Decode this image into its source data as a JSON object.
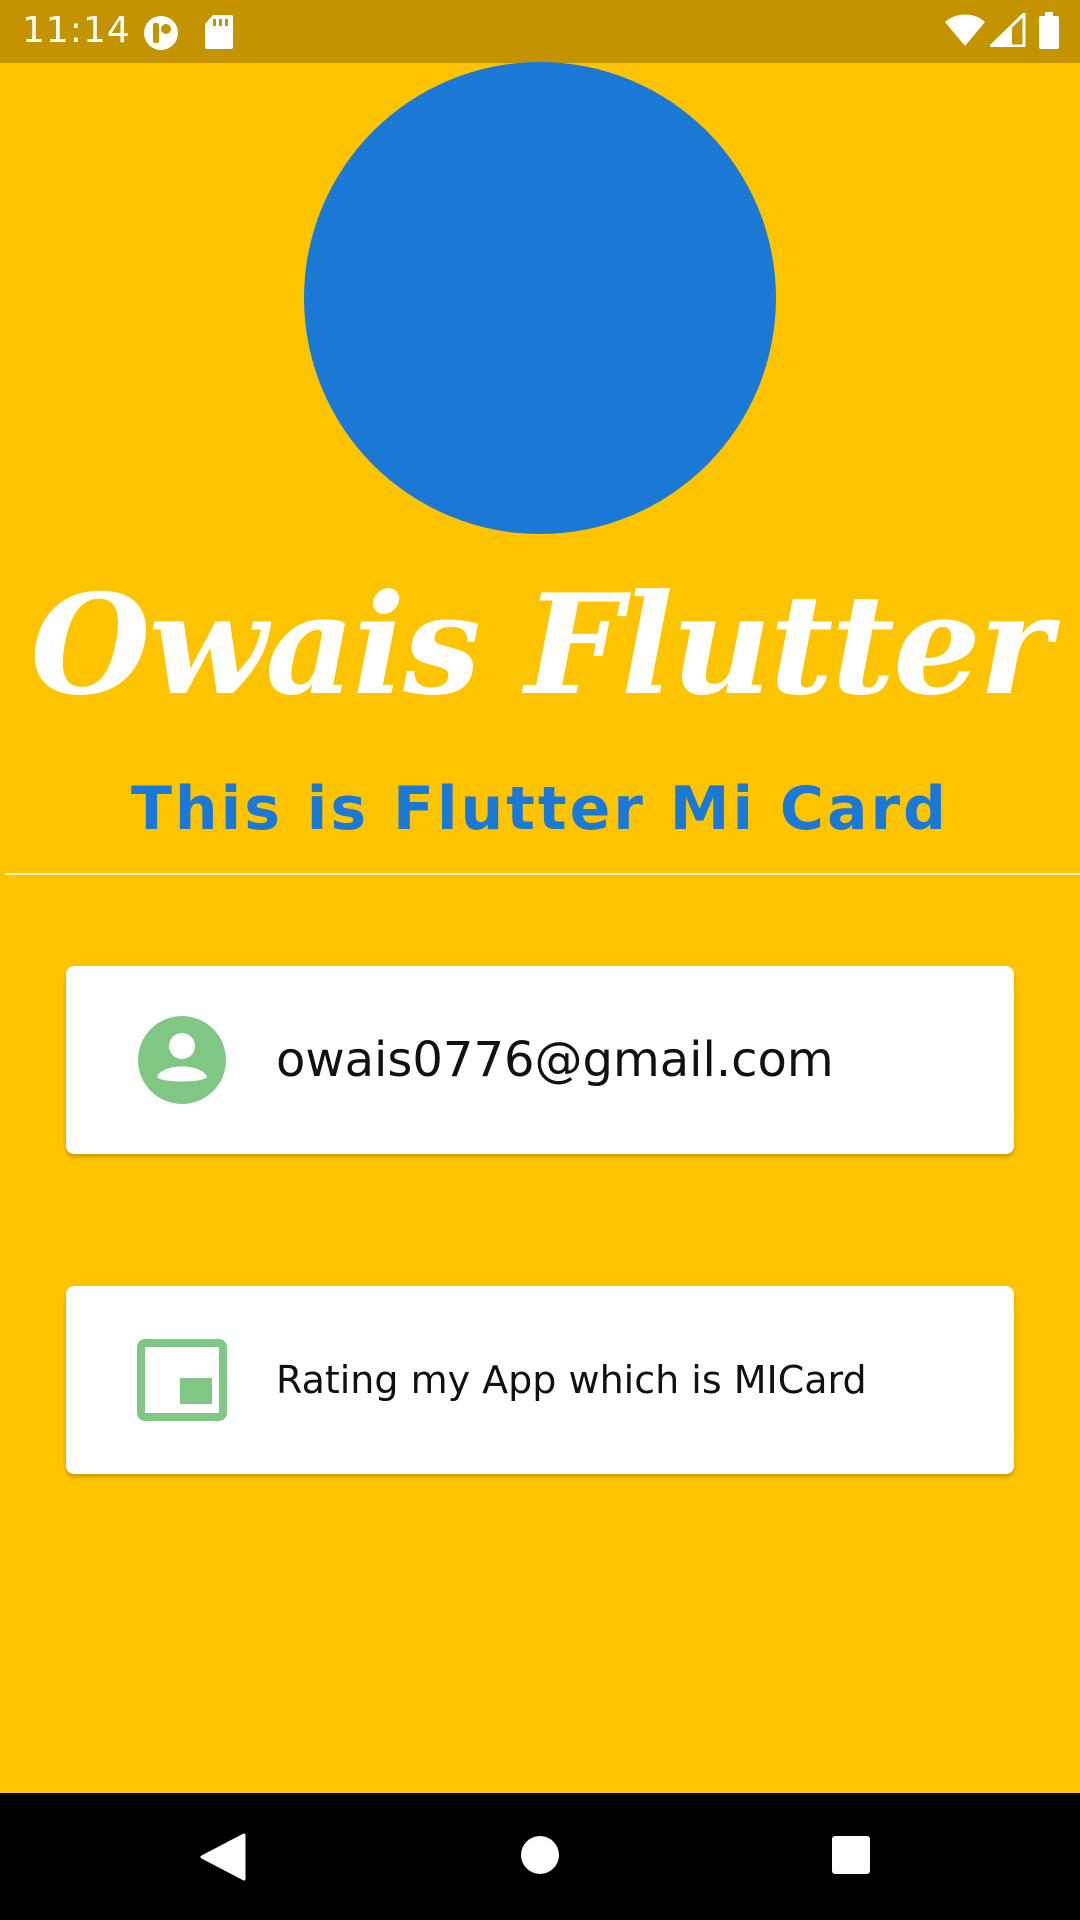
{
  "status_bar": {
    "time": "11:14",
    "left_icons": [
      "app-notification-icon",
      "sd-card-icon"
    ],
    "right_icons": [
      "wifi-icon",
      "signal-icon",
      "battery-icon"
    ],
    "background_color": "#C49400"
  },
  "profile": {
    "avatar_color": "#1B78D4",
    "name": "Owais Flutter",
    "subtitle": "This is Flutter Mi Card",
    "subtitle_color": "#1B78D4"
  },
  "cards": {
    "email": {
      "icon": "account-circle-icon",
      "text": "owais0776@gmail.com"
    },
    "rating": {
      "icon": "picture-in-picture-icon",
      "text": "Rating my App which is MICard"
    },
    "icon_color": "#81C784"
  },
  "background_color": "#FFC400",
  "nav_bar": {
    "buttons": [
      "back-icon",
      "home-icon",
      "recents-icon"
    ]
  }
}
